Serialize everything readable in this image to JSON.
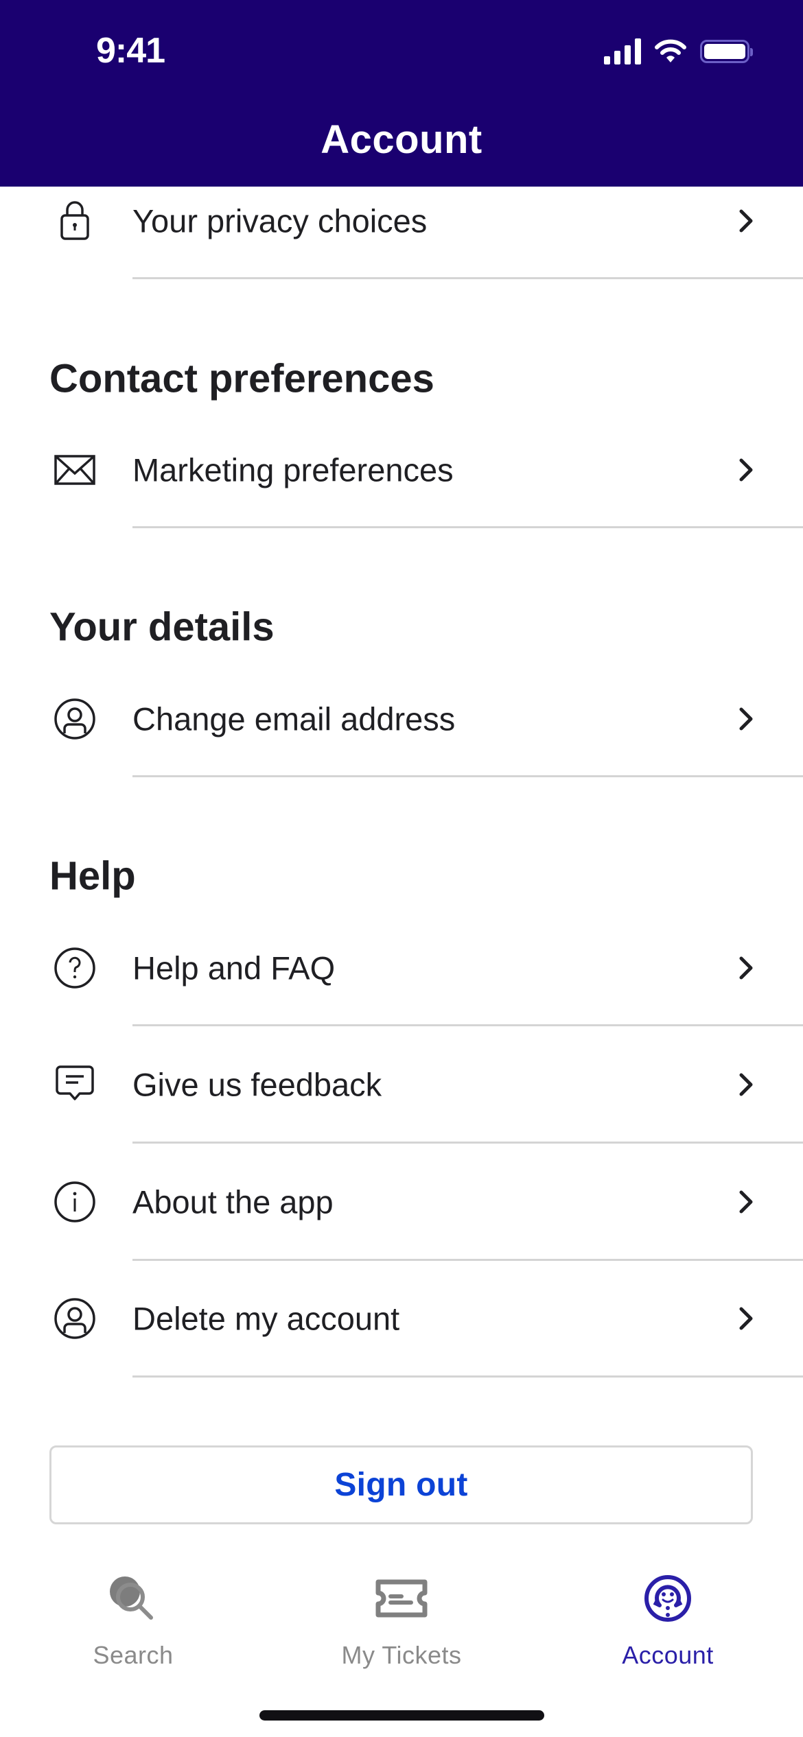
{
  "status_bar": {
    "time": "9:41",
    "icons": [
      "cellular-signal-icon",
      "wifi-icon",
      "battery-icon"
    ]
  },
  "header": {
    "title": "Account"
  },
  "colors": {
    "header_bg": "#1a0070",
    "text_primary": "#1f1f23",
    "link_blue": "#0c43d6",
    "tab_active": "#2a1fa8",
    "tab_inactive": "#8a8a8a",
    "divider": "#d4d4d4"
  },
  "sections": [
    {
      "title": null,
      "items": [
        {
          "label": "Your privacy choices",
          "icon": "lock-icon"
        }
      ]
    },
    {
      "title": "Contact preferences",
      "items": [
        {
          "label": "Marketing preferences",
          "icon": "envelope-icon"
        }
      ]
    },
    {
      "title": "Your details",
      "items": [
        {
          "label": "Change email address",
          "icon": "user-circle-icon"
        }
      ]
    },
    {
      "title": "Help",
      "items": [
        {
          "label": "Help and FAQ",
          "icon": "question-circle-icon"
        },
        {
          "label": "Give us feedback",
          "icon": "chat-bubble-icon"
        },
        {
          "label": "About the app",
          "icon": "info-circle-icon"
        },
        {
          "label": "Delete my account",
          "icon": "user-circle-icon"
        }
      ]
    }
  ],
  "sign_out": {
    "label": "Sign out"
  },
  "tab_bar": {
    "tabs": [
      {
        "label": "Search",
        "icon": "search-icon",
        "active": false
      },
      {
        "label": "My Tickets",
        "icon": "ticket-icon",
        "active": false
      },
      {
        "label": "Account",
        "icon": "account-mascot-icon",
        "active": true
      }
    ]
  }
}
